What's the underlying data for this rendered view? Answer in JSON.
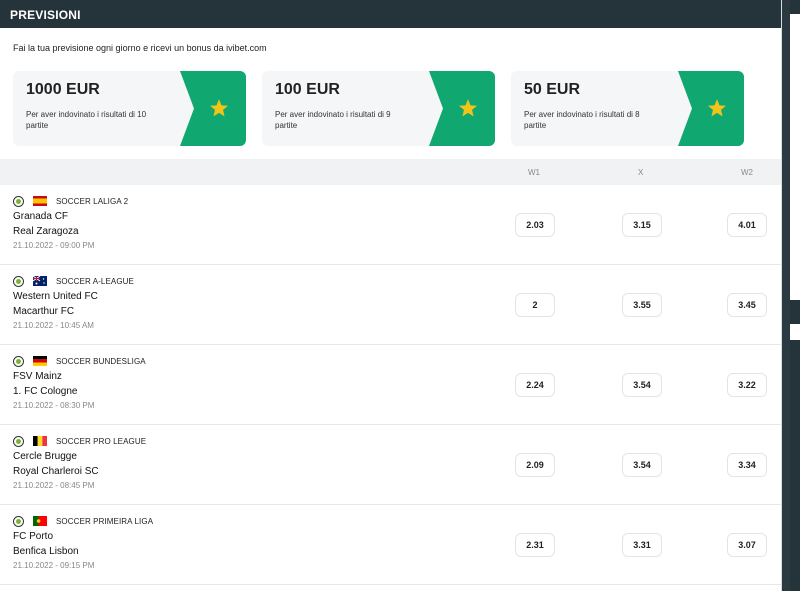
{
  "header": {
    "title": "PREVISIONI"
  },
  "intro": "Fai la tua previsione ogni giorno e ricevi un bonus da ivibet.com",
  "colors": {
    "accent": "#10a870",
    "header_bg": "#24343a",
    "star": "#f2c418"
  },
  "bonuses": [
    {
      "amount": "1000 EUR",
      "desc": "Per aver indovinato i risultati di 10 partite"
    },
    {
      "amount": "100 EUR",
      "desc": "Per aver indovinato i risultati di 9 partite"
    },
    {
      "amount": "50 EUR",
      "desc": "Per aver indovinato i risultati di 8 partite"
    }
  ],
  "columns": {
    "w1": "W1",
    "x": "X",
    "w2": "W2"
  },
  "matches": [
    {
      "league": "SOCCER LALIGA 2",
      "flag": "spain-flag-icon",
      "home": "Granada CF",
      "away": "Real Zaragoza",
      "date": "21.10.2022 - 09:00 PM",
      "w1": "2.03",
      "x": "3.15",
      "w2": "4.01"
    },
    {
      "league": "SOCCER A-LEAGUE",
      "flag": "australia-flag-icon",
      "home": "Western United FC",
      "away": "Macarthur FC",
      "date": "21.10.2022 - 10:45 AM",
      "w1": "2",
      "x": "3.55",
      "w2": "3.45"
    },
    {
      "league": "SOCCER BUNDESLIGA",
      "flag": "germany-flag-icon",
      "home": "FSV Mainz",
      "away": "1. FC Cologne",
      "date": "21.10.2022 - 08:30 PM",
      "w1": "2.24",
      "x": "3.54",
      "w2": "3.22"
    },
    {
      "league": "SOCCER PRO LEAGUE",
      "flag": "belgium-flag-icon",
      "home": "Cercle Brugge",
      "away": "Royal Charleroi SC",
      "date": "21.10.2022 - 08:45 PM",
      "w1": "2.09",
      "x": "3.54",
      "w2": "3.34"
    },
    {
      "league": "SOCCER PRIMEIRA LIGA",
      "flag": "portugal-flag-icon",
      "home": "FC Porto",
      "away": "Benfica Lisbon",
      "date": "21.10.2022 - 09:15 PM",
      "w1": "2.31",
      "x": "3.31",
      "w2": "3.07"
    }
  ]
}
